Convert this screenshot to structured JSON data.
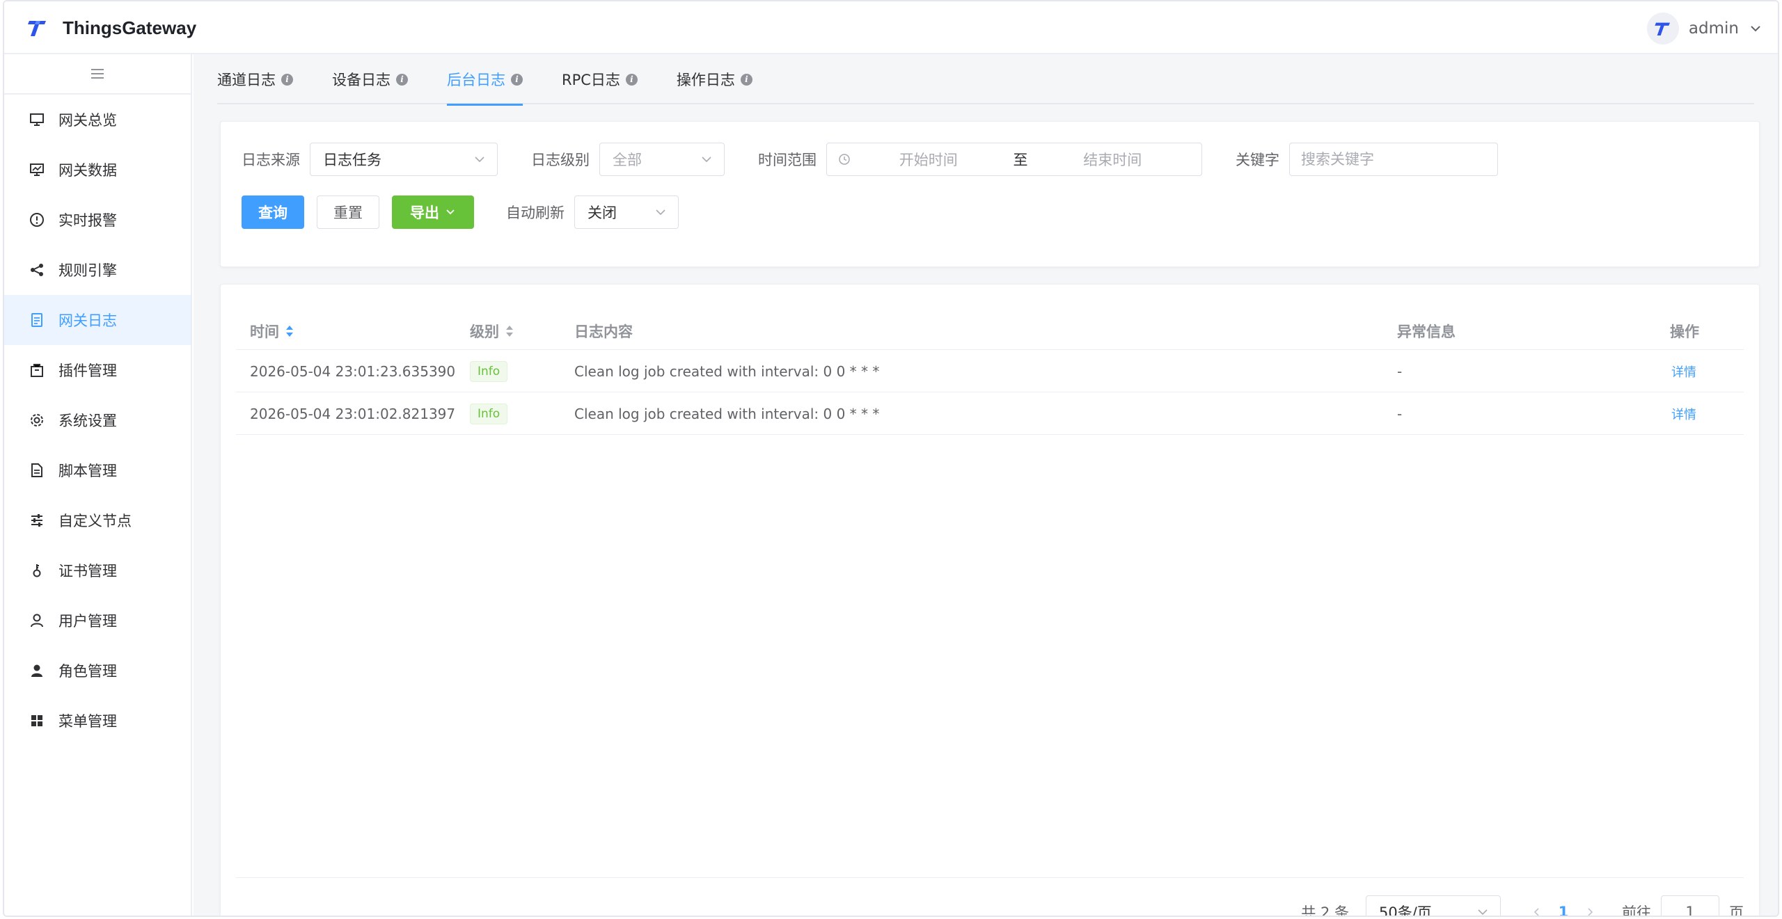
{
  "app": {
    "title": "ThingsGateway",
    "brand_color": "#2f54eb"
  },
  "user": {
    "name": "admin"
  },
  "sidebar": {
    "collapse_icon": "hamburger-icon",
    "items": [
      {
        "label": "网关总览",
        "icon": "monitor-icon",
        "active": false
      },
      {
        "label": "网关数据",
        "icon": "chart-monitor-icon",
        "active": false
      },
      {
        "label": "实时报警",
        "icon": "warning-circle-icon",
        "active": false
      },
      {
        "label": "规则引擎",
        "icon": "share-icon",
        "active": false
      },
      {
        "label": "网关日志",
        "icon": "document-icon",
        "active": true
      },
      {
        "label": "插件管理",
        "icon": "package-icon",
        "active": false
      },
      {
        "label": "系统设置",
        "icon": "gear-icon",
        "active": false
      },
      {
        "label": "脚本管理",
        "icon": "file-text-icon",
        "active": false
      },
      {
        "label": "自定义节点",
        "icon": "sliders-icon",
        "active": false
      },
      {
        "label": "证书管理",
        "icon": "key-icon",
        "active": false
      },
      {
        "label": "用户管理",
        "icon": "user-icon",
        "active": false
      },
      {
        "label": "角色管理",
        "icon": "user-filled-icon",
        "active": false
      },
      {
        "label": "菜单管理",
        "icon": "grid-icon",
        "active": false
      }
    ]
  },
  "tabs": [
    {
      "label": "通道日志",
      "active": false
    },
    {
      "label": "设备日志",
      "active": false
    },
    {
      "label": "后台日志",
      "active": true
    },
    {
      "label": "RPC日志",
      "active": false
    },
    {
      "label": "操作日志",
      "active": false
    }
  ],
  "filters": {
    "source_label": "日志来源",
    "source_value": "日志任务",
    "level_label": "日志级别",
    "level_value": "全部",
    "time_label": "时间范围",
    "time_start_placeholder": "开始时间",
    "time_sep": "至",
    "time_end_placeholder": "结束时间",
    "keyword_label": "关键字",
    "keyword_placeholder": "搜索关键字",
    "query_label": "查询",
    "reset_label": "重置",
    "export_label": "导出",
    "auto_refresh_label": "自动刷新",
    "auto_refresh_value": "关闭"
  },
  "table": {
    "columns": [
      "时间",
      "级别",
      "日志内容",
      "异常信息",
      "操作"
    ],
    "rows": [
      {
        "time": "2026-05-04 23:01:23.635390",
        "level": "Info",
        "content": "Clean log job created with interval: 0 0 * * *",
        "exception": "-",
        "action": "详情"
      },
      {
        "time": "2026-05-04 23:01:02.821397",
        "level": "Info",
        "content": "Clean log job created with interval: 0 0 * * *",
        "exception": "-",
        "action": "详情"
      }
    ]
  },
  "pagination": {
    "total_text": "共 2 条",
    "page_size": "50条/页",
    "current_page": "1",
    "goto_label": "前往",
    "goto_value": "1",
    "page_suffix": "页"
  }
}
